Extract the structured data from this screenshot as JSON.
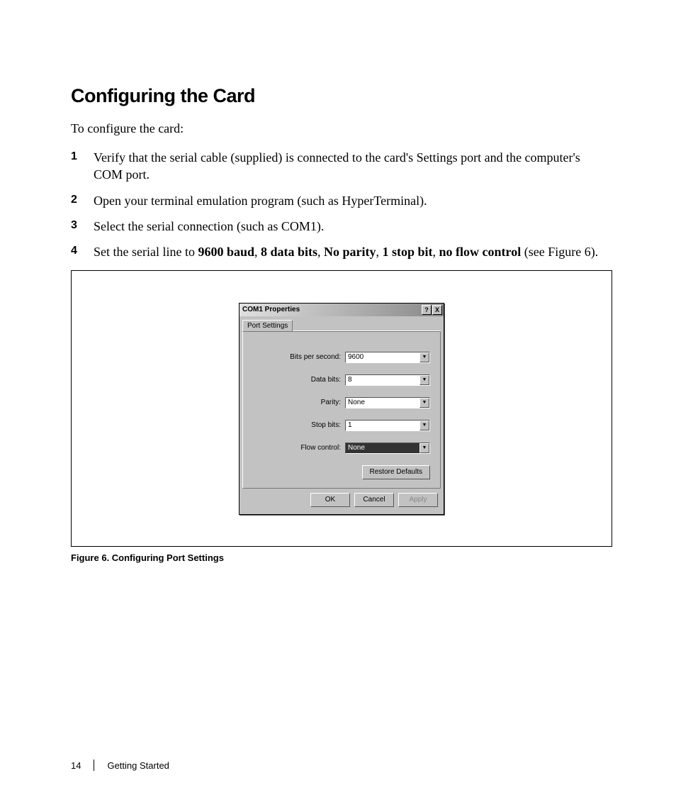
{
  "heading": "Configuring the Card",
  "intro": "To configure the card:",
  "steps": [
    {
      "num": "1",
      "text": "Verify that the serial cable (supplied) is connected to the card's Settings port and the computer's COM port."
    },
    {
      "num": "2",
      "text": "Open your terminal emulation program (such as HyperTerminal)."
    },
    {
      "num": "3",
      "text": "Select the serial connection (such as COM1)."
    },
    {
      "num": "4",
      "prefix": "Set the serial line to ",
      "b1": "9600 baud",
      "c1": ", ",
      "b2": "8 data bits",
      "c2": ", ",
      "b3": "No parity",
      "c3": ", ",
      "b4": "1 stop bit",
      "c4": ", ",
      "b5": "no flow control",
      "suffix": " (see Figure 6)."
    }
  ],
  "dialog": {
    "title": "COM1 Properties",
    "help_btn": "?",
    "close_btn": "X",
    "tab": "Port Settings",
    "fields": {
      "bits_per_second": {
        "label": "Bits per second:",
        "value": "9600"
      },
      "data_bits": {
        "label": "Data bits:",
        "value": "8"
      },
      "parity": {
        "label": "Parity:",
        "value": "None"
      },
      "stop_bits": {
        "label": "Stop bits:",
        "value": "1"
      },
      "flow_control": {
        "label": "Flow control:",
        "value": "None"
      }
    },
    "restore": "Restore Defaults",
    "ok": "OK",
    "cancel": "Cancel",
    "apply": "Apply"
  },
  "caption": "Figure 6. Configuring Port Settings",
  "footer": {
    "page": "14",
    "section": "Getting Started"
  }
}
